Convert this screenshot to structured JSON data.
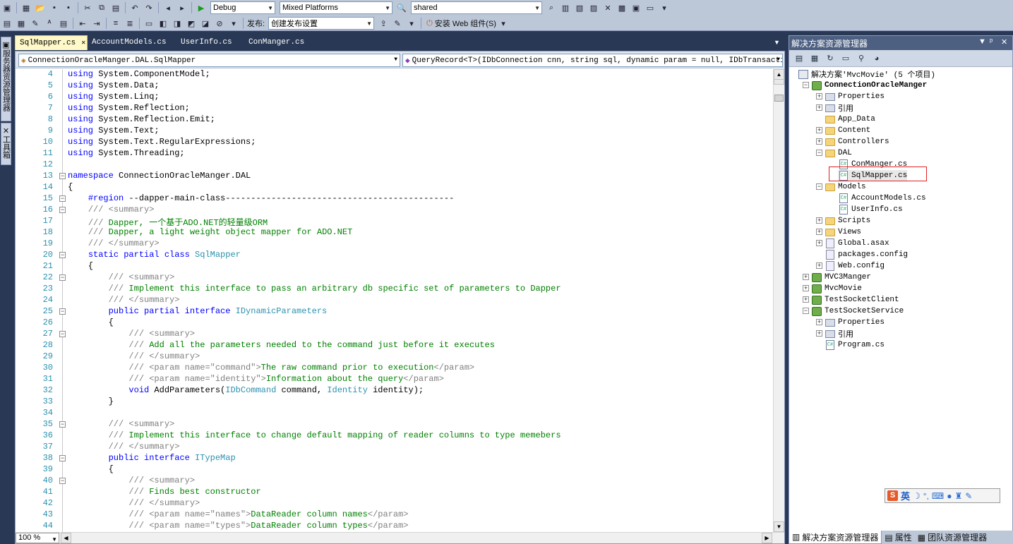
{
  "toolbar": {
    "config_combo": "Debug",
    "platform_combo": "Mixed Platforms",
    "find_combo": "shared",
    "publish_label": "发布:",
    "publish_combo": "创建发布设置",
    "install_label": "安装 Web 组件(S)"
  },
  "left_dock": {
    "server_explorer": "服务器资源管理器",
    "toolbox": "工具箱"
  },
  "doc_tabs": [
    {
      "label": "SqlMapper.cs",
      "active": true
    },
    {
      "label": "AccountModels.cs",
      "active": false
    },
    {
      "label": "UserInfo.cs",
      "active": false
    },
    {
      "label": "ConManger.cs",
      "active": false
    }
  ],
  "editor": {
    "type_combo": "ConnectionOracleManger.DAL.SqlMapper",
    "member_combo": "QueryRecord<T>(IDbConnection cnn, string sql, dynamic param = null, IDbTransaction t",
    "zoom": "100 %",
    "lines": [
      {
        "n": "4",
        "fold": "",
        "segs": [
          [
            "kw",
            "using"
          ],
          [
            "pl",
            " System.ComponentModel;"
          ]
        ]
      },
      {
        "n": "5",
        "fold": "",
        "segs": [
          [
            "kw",
            "using"
          ],
          [
            "pl",
            " System.Data;"
          ]
        ]
      },
      {
        "n": "6",
        "fold": "",
        "segs": [
          [
            "kw",
            "using"
          ],
          [
            "pl",
            " System.Linq;"
          ]
        ]
      },
      {
        "n": "7",
        "fold": "",
        "segs": [
          [
            "kw",
            "using"
          ],
          [
            "pl",
            " System.Reflection;"
          ]
        ]
      },
      {
        "n": "8",
        "fold": "",
        "segs": [
          [
            "kw",
            "using"
          ],
          [
            "pl",
            " System.Reflection.Emit;"
          ]
        ]
      },
      {
        "n": "9",
        "fold": "",
        "segs": [
          [
            "kw",
            "using"
          ],
          [
            "pl",
            " System.Text;"
          ]
        ]
      },
      {
        "n": "10",
        "fold": "",
        "segs": [
          [
            "kw",
            "using"
          ],
          [
            "pl",
            " System.Text.RegularExpressions;"
          ]
        ]
      },
      {
        "n": "11",
        "fold": "",
        "segs": [
          [
            "kw",
            "using"
          ],
          [
            "pl",
            " System.Threading;"
          ]
        ]
      },
      {
        "n": "12",
        "fold": "",
        "segs": []
      },
      {
        "n": "13",
        "fold": "−",
        "segs": [
          [
            "kw",
            "namespace"
          ],
          [
            "pl",
            " ConnectionOracleManger.DAL"
          ]
        ]
      },
      {
        "n": "14",
        "fold": "",
        "segs": [
          [
            "pl",
            "{"
          ]
        ]
      },
      {
        "n": "15",
        "fold": "−",
        "segs": [
          [
            "pl",
            "    "
          ],
          [
            "kw",
            "#region"
          ],
          [
            "pl",
            " --dapper-main-class---------------------------------------------"
          ]
        ]
      },
      {
        "n": "16",
        "fold": "−",
        "segs": [
          [
            "pl",
            "    "
          ],
          [
            "dc",
            "/// <summary>"
          ]
        ]
      },
      {
        "n": "17",
        "fold": "",
        "segs": [
          [
            "pl",
            "    "
          ],
          [
            "dc",
            "/// "
          ],
          [
            "cm",
            "Dapper, 一个基于ADO.NET的轻量级ORM"
          ]
        ]
      },
      {
        "n": "18",
        "fold": "",
        "segs": [
          [
            "pl",
            "    "
          ],
          [
            "dc",
            "/// "
          ],
          [
            "cm",
            "Dapper, a light weight object mapper for ADO.NET"
          ]
        ]
      },
      {
        "n": "19",
        "fold": "",
        "segs": [
          [
            "pl",
            "    "
          ],
          [
            "dc",
            "/// </summary>"
          ]
        ]
      },
      {
        "n": "20",
        "fold": "−",
        "segs": [
          [
            "pl",
            "    "
          ],
          [
            "kw",
            "static partial class"
          ],
          [
            "pl",
            " "
          ],
          [
            "ty",
            "SqlMapper"
          ]
        ]
      },
      {
        "n": "21",
        "fold": "",
        "segs": [
          [
            "pl",
            "    {"
          ]
        ]
      },
      {
        "n": "22",
        "fold": "−",
        "segs": [
          [
            "pl",
            "        "
          ],
          [
            "dc",
            "/// <summary>"
          ]
        ]
      },
      {
        "n": "23",
        "fold": "",
        "segs": [
          [
            "pl",
            "        "
          ],
          [
            "dc",
            "/// "
          ],
          [
            "cm",
            "Implement this interface to pass an arbitrary db specific set of parameters to Dapper"
          ]
        ]
      },
      {
        "n": "24",
        "fold": "",
        "segs": [
          [
            "pl",
            "        "
          ],
          [
            "dc",
            "/// </summary>"
          ]
        ]
      },
      {
        "n": "25",
        "fold": "−",
        "segs": [
          [
            "pl",
            "        "
          ],
          [
            "kw",
            "public partial interface"
          ],
          [
            "pl",
            " "
          ],
          [
            "ty",
            "IDynamicParameters"
          ]
        ]
      },
      {
        "n": "26",
        "fold": "",
        "segs": [
          [
            "pl",
            "        {"
          ]
        ]
      },
      {
        "n": "27",
        "fold": "−",
        "segs": [
          [
            "pl",
            "            "
          ],
          [
            "dc",
            "/// <summary>"
          ]
        ]
      },
      {
        "n": "28",
        "fold": "",
        "segs": [
          [
            "pl",
            "            "
          ],
          [
            "dc",
            "/// "
          ],
          [
            "cm",
            "Add all the parameters needed to the command just before it executes"
          ]
        ]
      },
      {
        "n": "29",
        "fold": "",
        "segs": [
          [
            "pl",
            "            "
          ],
          [
            "dc",
            "/// </summary>"
          ]
        ]
      },
      {
        "n": "30",
        "fold": "",
        "segs": [
          [
            "pl",
            "            "
          ],
          [
            "dc",
            "/// <param name=\"command\">"
          ],
          [
            "cm",
            "The raw command prior to execution"
          ],
          [
            "dc",
            "</param>"
          ]
        ]
      },
      {
        "n": "31",
        "fold": "",
        "segs": [
          [
            "pl",
            "            "
          ],
          [
            "dc",
            "/// <param name=\"identity\">"
          ],
          [
            "cm",
            "Information about the query"
          ],
          [
            "dc",
            "</param>"
          ]
        ]
      },
      {
        "n": "32",
        "fold": "",
        "segs": [
          [
            "pl",
            "            "
          ],
          [
            "kw",
            "void"
          ],
          [
            "pl",
            " AddParameters("
          ],
          [
            "ty",
            "IDbCommand"
          ],
          [
            "pl",
            " command, "
          ],
          [
            "ty",
            "Identity"
          ],
          [
            "pl",
            " identity);"
          ]
        ]
      },
      {
        "n": "33",
        "fold": "",
        "segs": [
          [
            "pl",
            "        }"
          ]
        ]
      },
      {
        "n": "34",
        "fold": "",
        "segs": []
      },
      {
        "n": "35",
        "fold": "−",
        "segs": [
          [
            "pl",
            "        "
          ],
          [
            "dc",
            "/// <summary>"
          ]
        ]
      },
      {
        "n": "36",
        "fold": "",
        "segs": [
          [
            "pl",
            "        "
          ],
          [
            "dc",
            "/// "
          ],
          [
            "cm",
            "Implement this interface to change default mapping of reader columns to type memebers"
          ]
        ]
      },
      {
        "n": "37",
        "fold": "",
        "segs": [
          [
            "pl",
            "        "
          ],
          [
            "dc",
            "/// </summary>"
          ]
        ]
      },
      {
        "n": "38",
        "fold": "−",
        "segs": [
          [
            "pl",
            "        "
          ],
          [
            "kw",
            "public interface"
          ],
          [
            "pl",
            " "
          ],
          [
            "ty",
            "ITypeMap"
          ]
        ]
      },
      {
        "n": "39",
        "fold": "",
        "segs": [
          [
            "pl",
            "        {"
          ]
        ]
      },
      {
        "n": "40",
        "fold": "−",
        "segs": [
          [
            "pl",
            "            "
          ],
          [
            "dc",
            "/// <summary>"
          ]
        ]
      },
      {
        "n": "41",
        "fold": "",
        "segs": [
          [
            "pl",
            "            "
          ],
          [
            "dc",
            "/// "
          ],
          [
            "cm",
            "Finds best constructor"
          ]
        ]
      },
      {
        "n": "42",
        "fold": "",
        "segs": [
          [
            "pl",
            "            "
          ],
          [
            "dc",
            "/// </summary>"
          ]
        ]
      },
      {
        "n": "43",
        "fold": "",
        "segs": [
          [
            "pl",
            "            "
          ],
          [
            "dc",
            "/// <param name=\"names\">"
          ],
          [
            "cm",
            "DataReader column names"
          ],
          [
            "dc",
            "</param>"
          ]
        ]
      },
      {
        "n": "44",
        "fold": "",
        "segs": [
          [
            "pl",
            "            "
          ],
          [
            "dc",
            "/// <param name=\"types\">"
          ],
          [
            "cm",
            "DataReader column types"
          ],
          [
            "dc",
            "</param>"
          ]
        ]
      }
    ]
  },
  "solution_explorer": {
    "title": "解决方案资源管理器",
    "nodes": [
      {
        "label": "解决方案'MvcMovie' (5 个项目)",
        "depth": 0,
        "exp": "",
        "icon": "sol",
        "bold": false
      },
      {
        "label": "ConnectionOracleManger",
        "depth": 1,
        "exp": "−",
        "icon": "proj",
        "bold": true
      },
      {
        "label": "Properties",
        "depth": 2,
        "exp": "+",
        "icon": "refs",
        "bold": false
      },
      {
        "label": "引用",
        "depth": 2,
        "exp": "+",
        "icon": "refs",
        "bold": false
      },
      {
        "label": "App_Data",
        "depth": 2,
        "exp": "",
        "icon": "folder",
        "bold": false
      },
      {
        "label": "Content",
        "depth": 2,
        "exp": "+",
        "icon": "folder",
        "bold": false
      },
      {
        "label": "Controllers",
        "depth": 2,
        "exp": "+",
        "icon": "folder",
        "bold": false
      },
      {
        "label": "DAL",
        "depth": 2,
        "exp": "−",
        "icon": "folder",
        "bold": false
      },
      {
        "label": "ConManger.cs",
        "depth": 3,
        "exp": "",
        "icon": "cs",
        "bold": false
      },
      {
        "label": "SqlMapper.cs",
        "depth": 3,
        "exp": "",
        "icon": "cs",
        "bold": false,
        "selected": true
      },
      {
        "label": "Models",
        "depth": 2,
        "exp": "−",
        "icon": "folder",
        "bold": false
      },
      {
        "label": "AccountModels.cs",
        "depth": 3,
        "exp": "",
        "icon": "cs",
        "bold": false
      },
      {
        "label": "UserInfo.cs",
        "depth": 3,
        "exp": "",
        "icon": "cs",
        "bold": false
      },
      {
        "label": "Scripts",
        "depth": 2,
        "exp": "+",
        "icon": "folder",
        "bold": false
      },
      {
        "label": "Views",
        "depth": 2,
        "exp": "+",
        "icon": "folder",
        "bold": false
      },
      {
        "label": "Global.asax",
        "depth": 2,
        "exp": "+",
        "icon": "cfg",
        "bold": false
      },
      {
        "label": "packages.config",
        "depth": 2,
        "exp": "",
        "icon": "cfg",
        "bold": false
      },
      {
        "label": "Web.config",
        "depth": 2,
        "exp": "+",
        "icon": "cfg",
        "bold": false
      },
      {
        "label": "MVC3Manger",
        "depth": 1,
        "exp": "+",
        "icon": "proj",
        "bold": false
      },
      {
        "label": "MvcMovie",
        "depth": 1,
        "exp": "+",
        "icon": "proj",
        "bold": false
      },
      {
        "label": "TestSocketClient",
        "depth": 1,
        "exp": "+",
        "icon": "proj",
        "bold": false
      },
      {
        "label": "TestSocketService",
        "depth": 1,
        "exp": "−",
        "icon": "proj",
        "bold": false
      },
      {
        "label": "Properties",
        "depth": 2,
        "exp": "+",
        "icon": "refs",
        "bold": false
      },
      {
        "label": "引用",
        "depth": 2,
        "exp": "+",
        "icon": "refs",
        "bold": false
      },
      {
        "label": "Program.cs",
        "depth": 2,
        "exp": "",
        "icon": "cs",
        "bold": false
      }
    ],
    "bottom_tabs": [
      "解决方案资源管理器",
      "属性",
      "团队资源管理器"
    ]
  },
  "ime": {
    "mode": "英"
  }
}
